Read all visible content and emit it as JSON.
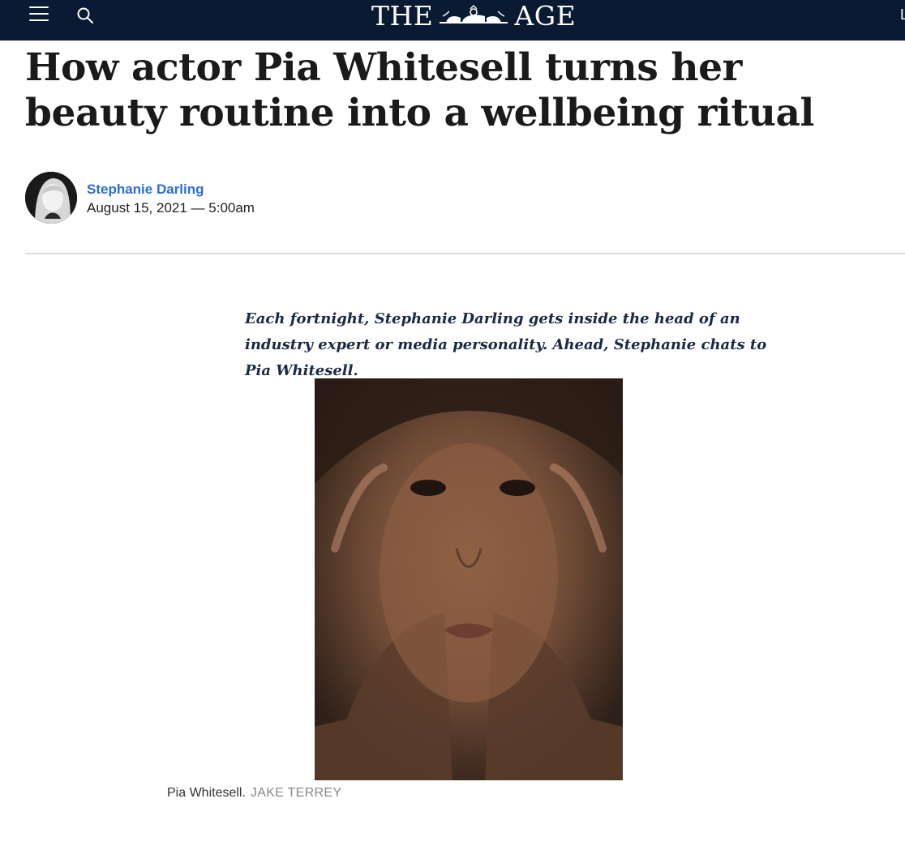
{
  "header": {
    "masthead_left": "THE",
    "masthead_right": "AGE",
    "login_peek": "L",
    "icons": {
      "menu": "hamburger-icon",
      "search": "search-icon",
      "crest": "crest-logo"
    }
  },
  "article": {
    "headline": "How actor Pia Whitesell turns her beauty routine into a wellbeing ritual",
    "author": "Stephanie Darling",
    "date": "August 15, 2021 — 5:00am",
    "intro": "Each fortnight, Stephanie Darling gets inside the head of an industry expert or media personality. Ahead, Stephanie chats to Pia Whitesell.",
    "caption": "Pia Whitesell.",
    "credit": "JAKE TERREY"
  },
  "colors": {
    "header_bg": "#0a1a33",
    "author_link": "#2a6ed8"
  }
}
